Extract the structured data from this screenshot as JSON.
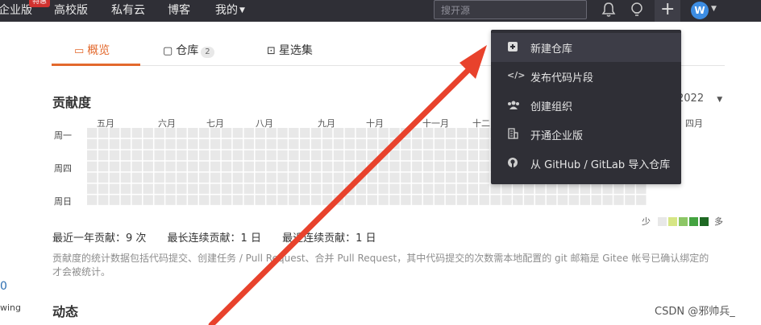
{
  "topbar": {
    "nav": [
      {
        "label": "企业版",
        "badge": "特惠"
      },
      {
        "label": "高校版"
      },
      {
        "label": "私有云"
      },
      {
        "label": "博客"
      },
      {
        "label": "我的"
      }
    ],
    "search_placeholder": "搜开源",
    "avatar_letter": "W"
  },
  "tabs": [
    {
      "label": "概览",
      "active": true
    },
    {
      "label": "仓库",
      "count": "2"
    },
    {
      "label": "星选集"
    }
  ],
  "contribution": {
    "title": "贡献度",
    "year": "2022",
    "months": [
      "五月",
      "六月",
      "七月",
      "八月",
      "九月",
      "十月",
      "十一月",
      "十二",
      "四月"
    ],
    "weekdays": [
      "周一",
      "周四",
      "周日"
    ],
    "legend_less": "少",
    "legend_more": "多",
    "levels": [
      "#e8e8e8",
      "#d6e685",
      "#8cc665",
      "#44a340",
      "#1e6823"
    ],
    "stats": [
      "最近一年贡献：9 次",
      "最长连续贡献：1 日",
      "最近连续贡献：1 日"
    ],
    "note": "贡献度的统计数据包括代码提交、创建任务 / Pull Request、合并 Pull Request，其中代码提交的次数需本地配置的 git 邮箱是 Gitee 帐号已确认绑定的才会被统计。"
  },
  "activity_title": "动态",
  "sidebar_fragments": [
    "0",
    "wing"
  ],
  "new_menu": [
    {
      "label": "新建仓库",
      "icon": "plus-square-icon",
      "glyph": "⊞"
    },
    {
      "label": "发布代码片段",
      "icon": "code-icon",
      "glyph": "</>"
    },
    {
      "label": "创建组织",
      "icon": "group-icon",
      "glyph": "⚇"
    },
    {
      "label": "开通企业版",
      "icon": "building-icon",
      "glyph": "▦"
    },
    {
      "label": "从 GitHub / GitLab 导入仓库",
      "icon": "github-icon",
      "glyph": "◉"
    }
  ],
  "watermark": "CSDN @邪帅兵_",
  "accent": "#e3692d",
  "annotation_color": "#e8422c"
}
